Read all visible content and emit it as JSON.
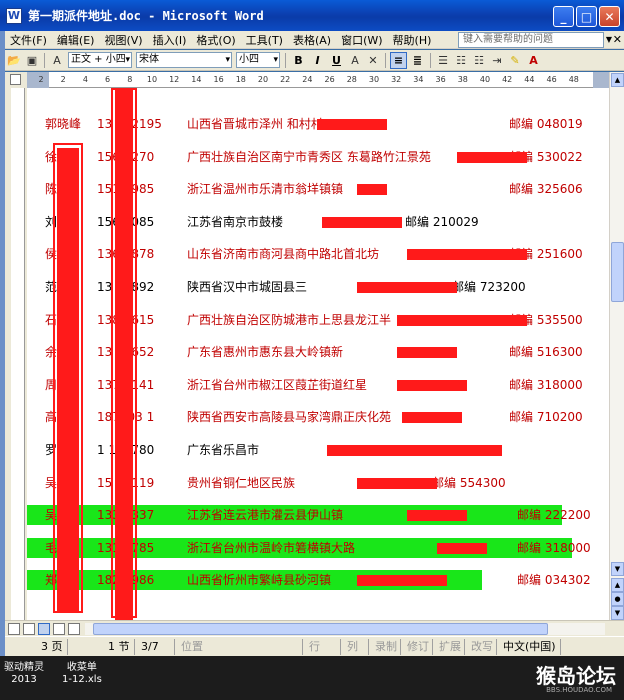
{
  "window": {
    "title": "第一期派件地址.doc - Microsoft Word",
    "minimize": "_",
    "maximize": "□",
    "close": "✕"
  },
  "menu": {
    "items": [
      "文件(F)",
      "编辑(E)",
      "视图(V)",
      "插入(I)",
      "格式(O)",
      "工具(T)",
      "表格(A)",
      "窗口(W)",
      "帮助(H)"
    ],
    "help_placeholder": "键入需要帮助的问题",
    "help_close": "✕"
  },
  "toolbar": {
    "style": "正文 + 小四",
    "font": "宋体",
    "size": "小四",
    "bold": "B",
    "italic": "I",
    "underline": "U",
    "font_color_glyph": "A"
  },
  "ruler": {
    "ticks": [
      "2",
      "2",
      "4",
      "6",
      "8",
      "10",
      "12",
      "14",
      "16",
      "18",
      "20",
      "22",
      "24",
      "26",
      "28",
      "30",
      "32",
      "34",
      "36",
      "38",
      "40",
      "42",
      "44",
      "46",
      "48"
    ]
  },
  "document": {
    "rows": [
      {
        "name": "郭晓峰",
        "phone": "13 142195",
        "address": "山西省晋城市泽州 和村村",
        "zip": "邮编 048019",
        "color": "red",
        "hl": false
      },
      {
        "name": "徐",
        "phone": "1567 270",
        "address": "广西壮族自治区南宁市青秀区 东葛路竹江景苑",
        "zip": "邮编 530022",
        "color": "red",
        "hl": false
      },
      {
        "name": "陈 瑞",
        "phone": "151 0985",
        "address": "浙江省温州市乐清市翁垟镇镇",
        "zip": "邮编 325606",
        "color": "red",
        "hl": false
      },
      {
        "name": "刘",
        "phone": "156 6085",
        "address": "江苏省南京市鼓楼",
        "zip": "邮编 210029",
        "color": "black",
        "hl": false
      },
      {
        "name": "侯",
        "phone": "1367 878",
        "address": "山东省济南市商河县商中路北首北坊",
        "zip": "邮编 251600",
        "color": "red",
        "hl": false
      },
      {
        "name": "范 站",
        "phone": "13 21892",
        "address": "陕西省汉中市城固县三",
        "zip": "邮编 723200",
        "color": "black",
        "hl": false
      },
      {
        "name": "石 辉",
        "phone": "1387 615",
        "address": "广西壮族自治区防城港市上思县龙江半",
        "zip": "邮编 535500",
        "color": "red",
        "hl": false
      },
      {
        "name": "余 亿",
        "phone": "13 50652",
        "address": "广东省惠州市惠东县大岭镇新",
        "zip": "邮编 516300",
        "color": "red",
        "hl": false
      },
      {
        "name": "周 强",
        "phone": "137 8141",
        "address": "浙江省台州市椒江区葭芷街道红星",
        "zip": "邮编 318000",
        "color": "red",
        "hl": false
      },
      {
        "name": "高",
        "phone": "187103 1",
        "address": "陕西省西安市高陵县马家湾鼎正庆化苑",
        "zip": "邮编 710200",
        "color": "red",
        "hl": false
      },
      {
        "name": "罗 林",
        "phone": "1 199780",
        "address": "广东省乐昌市",
        "zip": "",
        "color": "black",
        "hl": false
      },
      {
        "name": "吴 东",
        "phone": "15 82119",
        "address": "贵州省铜仁地区民族",
        "zip": "邮编 554300",
        "color": "red",
        "hl": false
      },
      {
        "name": "吴",
        "phone": "133 2337",
        "address": "江苏省连云港市灌云县伊山镇",
        "zip": "邮编 222200",
        "color": "red",
        "hl": true
      },
      {
        "name": "毛",
        "phone": "131 1785",
        "address": "浙江省台州市温岭市箬横镇大路",
        "zip": "邮编 318000",
        "color": "red",
        "hl": true
      },
      {
        "name": "郑",
        "phone": "182 5986",
        "address": "山西省忻州市繁峙县砂河镇",
        "zip": "邮编 034302",
        "color": "red",
        "hl": true
      }
    ]
  },
  "status": {
    "page": "3 页",
    "section": "1 节",
    "pages": "3/7",
    "position": "位置",
    "line": "行",
    "col": "列",
    "rec": "录制",
    "trk": "修订",
    "ext": "扩展",
    "ovr": "改写",
    "lang": "中文(中国)"
  },
  "taskbar": {
    "item1_line1": "驱动精灵",
    "item1_line2": "2013",
    "item2_line1": "收菜单",
    "item2_line2": "1-12.xls",
    "watermark": "猴岛论坛",
    "watermark_sub": "BBS.HOUDAO.COM"
  },
  "colors": {
    "title_bar": "#0b3fb0",
    "highlight": "#19e619",
    "redaction": "#ff1a1a",
    "text_red": "#c00000"
  }
}
